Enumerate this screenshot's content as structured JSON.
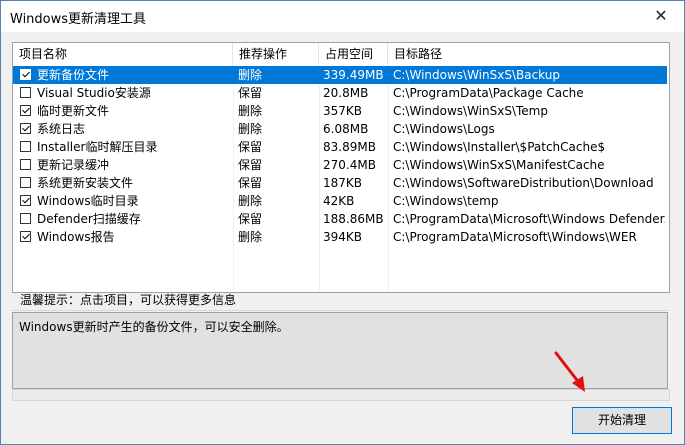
{
  "window": {
    "title": "Windows更新清理工具",
    "close_symbol": "✕"
  },
  "table": {
    "headers": [
      "项目名称",
      "推荐操作",
      "占用空间",
      "目标路径"
    ],
    "rows": [
      {
        "checked": true,
        "name": "更新备份文件",
        "action": "删除",
        "size": "339.49MB",
        "path": "C:\\Windows\\WinSxS\\Backup",
        "selected": true
      },
      {
        "checked": false,
        "name": "Visual Studio安装源",
        "action": "保留",
        "size": "20.8MB",
        "path": "C:\\ProgramData\\Package Cache"
      },
      {
        "checked": true,
        "name": "临时更新文件",
        "action": "删除",
        "size": "357KB",
        "path": "C:\\Windows\\WinSxS\\Temp"
      },
      {
        "checked": true,
        "name": "系统日志",
        "action": "删除",
        "size": "6.08MB",
        "path": "C:\\Windows\\Logs"
      },
      {
        "checked": false,
        "name": "Installer临时解压目录",
        "action": "保留",
        "size": "83.89MB",
        "path": "C:\\Windows\\Installer\\$PatchCache$"
      },
      {
        "checked": false,
        "name": "更新记录缓冲",
        "action": "保留",
        "size": "270.4MB",
        "path": "C:\\Windows\\WinSxS\\ManifestCache"
      },
      {
        "checked": false,
        "name": "系统更新安装文件",
        "action": "保留",
        "size": "187KB",
        "path": "C:\\Windows\\SoftwareDistribution\\Download"
      },
      {
        "checked": true,
        "name": "Windows临时目录",
        "action": "删除",
        "size": "42KB",
        "path": "C:\\Windows\\temp"
      },
      {
        "checked": false,
        "name": "Defender扫描缓存",
        "action": "保留",
        "size": "188.86MB",
        "path": "C:\\ProgramData\\Microsoft\\Windows Defender..."
      },
      {
        "checked": true,
        "name": "Windows报告",
        "action": "删除",
        "size": "394KB",
        "path": "C:\\ProgramData\\Microsoft\\Windows\\WER"
      }
    ]
  },
  "hint": {
    "label": "温馨提示：点击项目，可以获得更多信息",
    "description": "Windows更新时产生的备份文件，可以安全删除。"
  },
  "buttons": {
    "start": "开始清理"
  },
  "colors": {
    "selection": "#0078d7",
    "annotation_arrow": "#e11010"
  }
}
